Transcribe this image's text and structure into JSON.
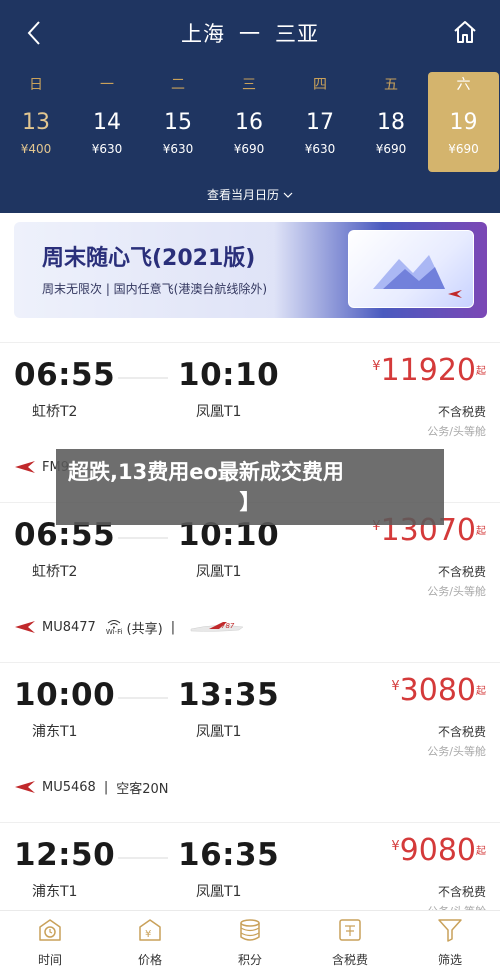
{
  "header": {
    "origin": "上海",
    "separator": "一",
    "destination": "三亚",
    "month_calendar_link": "查看当月日历"
  },
  "days": [
    {
      "weekday": "日",
      "day": "13",
      "price": "¥400"
    },
    {
      "weekday": "一",
      "day": "14",
      "price": "¥630"
    },
    {
      "weekday": "二",
      "day": "15",
      "price": "¥630"
    },
    {
      "weekday": "三",
      "day": "16",
      "price": "¥690"
    },
    {
      "weekday": "四",
      "day": "17",
      "price": "¥630"
    },
    {
      "weekday": "五",
      "day": "18",
      "price": "¥690"
    },
    {
      "weekday": "六",
      "day": "19",
      "price": "¥690",
      "selected": true
    }
  ],
  "banner": {
    "title": "周末随心飞(2021版)",
    "subtitle": "周末无限次 | 国内任意飞(港澳台航线除外)"
  },
  "flights": [
    {
      "dep_time": "06:55",
      "arr_time": "10:10",
      "dep_airport": "虹桥T2",
      "arr_airport": "凤凰T1",
      "currency": "¥",
      "price": "11920",
      "price_suffix": "起",
      "tax_note": "不含税费",
      "cabin": "公务/头等舱",
      "flight_no": "FM9",
      "extra": ""
    },
    {
      "dep_time": "06:55",
      "arr_time": "10:10",
      "dep_airport": "虹桥T2",
      "arr_airport": "凤凰T1",
      "currency": "¥",
      "price": "13070",
      "price_suffix": "起",
      "tax_note": "不含税费",
      "cabin": "公务/头等舱",
      "flight_no": "MU8477",
      "wifi_label": "Wi-Fi",
      "extra": "(共享)",
      "plane": "787"
    },
    {
      "dep_time": "10:00",
      "arr_time": "13:35",
      "dep_airport": "浦东T1",
      "arr_airport": "凤凰T1",
      "currency": "¥",
      "price": "3080",
      "price_suffix": "起",
      "tax_note": "不含税费",
      "cabin": "公务/头等舱",
      "flight_no": "MU5468",
      "extra": "空客20N"
    },
    {
      "dep_time": "12:50",
      "arr_time": "16:35",
      "dep_airport": "浦东T1",
      "arr_airport": "凤凰T1",
      "currency": "¥",
      "price": "9080",
      "price_suffix": "起",
      "tax_note": "不含税费",
      "cabin": "公务/头等舱",
      "flight_no": "",
      "extra": ""
    }
  ],
  "overlay": {
    "line1": "超跌,13费用eo最新成交费用",
    "line2": "】"
  },
  "nav": [
    {
      "label": "时间",
      "icon": "clock-icon"
    },
    {
      "label": "价格",
      "icon": "price-tag-icon"
    },
    {
      "label": "积分",
      "icon": "coins-icon"
    },
    {
      "label": "含税费",
      "icon": "tax-icon"
    },
    {
      "label": "筛选",
      "icon": "filter-icon"
    }
  ],
  "colors": {
    "header_bg": "#1f3561",
    "accent_gold": "#d4b46d",
    "price_red": "#d43a3a"
  }
}
